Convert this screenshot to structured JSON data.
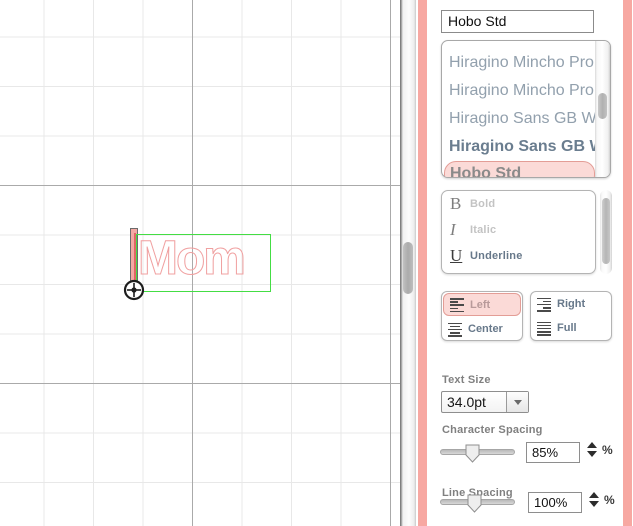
{
  "canvas": {
    "text_object": {
      "content": "Mom",
      "outline_color": "#f0a0a0",
      "bbox_color": "#44dd44",
      "handle_icon": "move-crosshair-icon",
      "insertion_bar_color": "#e06666"
    },
    "grid": {
      "minor_color": "#e8e8e8",
      "major_color": "#aaaaaa"
    },
    "scrollbar": {
      "orientation": "vertical"
    }
  },
  "panel": {
    "font_name": {
      "value": "Hobo Std",
      "placeholder": "Font name"
    },
    "font_list": {
      "items": [
        {
          "label": "Hiragino Mincho Pro",
          "style": "normal",
          "selected": false
        },
        {
          "label": "Hiragino Mincho Pro",
          "style": "normal",
          "selected": false
        },
        {
          "label": "Hiragino Sans GB W",
          "style": "normal",
          "selected": false
        },
        {
          "label": "Hiragino Sans GB W",
          "style": "bold",
          "selected": false
        },
        {
          "label": "Hobo Std",
          "style": "bold",
          "selected": true
        }
      ],
      "selection_color": "#fbdad7",
      "selection_border": "#e39d96"
    },
    "text_styles": [
      {
        "glyph": "B",
        "label": "Bold",
        "icon": "bold-icon",
        "active": false
      },
      {
        "glyph": "I",
        "label": "Italic",
        "icon": "italic-icon",
        "active": false
      },
      {
        "glyph": "U",
        "label": "Underline",
        "icon": "underline-icon",
        "active": true
      }
    ],
    "alignment": {
      "left_column": [
        {
          "label": "Left",
          "icon": "align-left-icon",
          "selected": true
        },
        {
          "label": "Center",
          "icon": "align-center-icon",
          "selected": false
        }
      ],
      "right_column": [
        {
          "label": "Right",
          "icon": "align-right-icon",
          "selected": false
        },
        {
          "label": "Full",
          "icon": "align-justify-icon",
          "selected": false
        }
      ]
    },
    "text_size": {
      "label": "Text Size",
      "value": "34.0pt",
      "dropdown_icon": "chevron-down-icon"
    },
    "character_spacing": {
      "label": "Character Spacing",
      "value": "85%",
      "unit": "%",
      "slider_position_pct": 35
    },
    "line_spacing": {
      "label": "Line Spacing",
      "value": "100%",
      "unit": "%",
      "slider_position_pct": 38
    }
  }
}
